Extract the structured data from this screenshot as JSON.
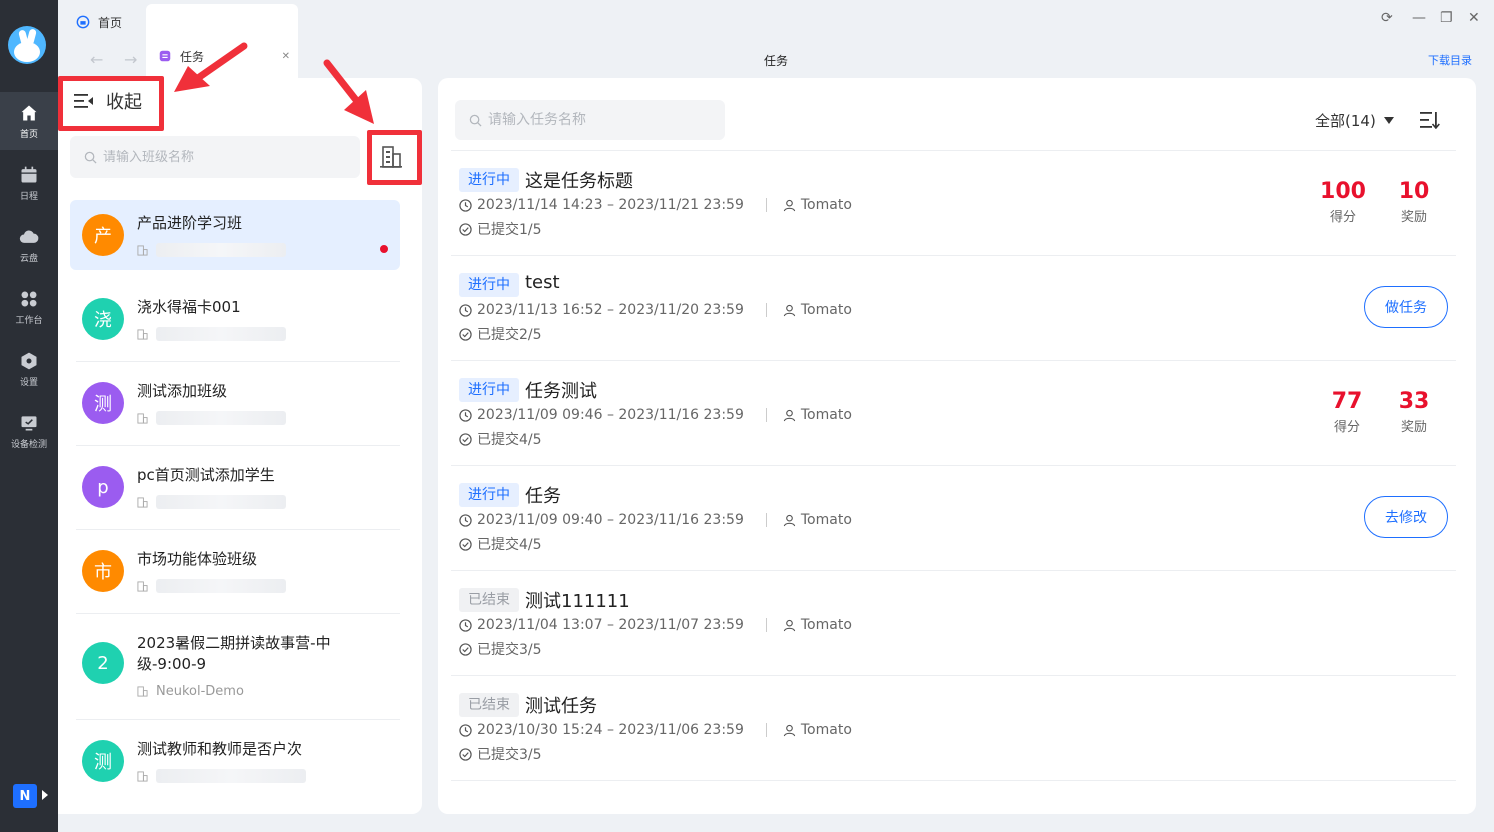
{
  "tabs": [
    {
      "label": "首页"
    },
    {
      "label": "任务"
    }
  ],
  "nav": {
    "title": "任务",
    "download": "下载目录"
  },
  "rail": [
    {
      "label": "首页",
      "icon": "home-icon"
    },
    {
      "label": "日程",
      "icon": "calendar-icon"
    },
    {
      "label": "云盘",
      "icon": "cloud-icon"
    },
    {
      "label": "工作台",
      "icon": "grid-icon"
    },
    {
      "label": "设置",
      "icon": "settings-icon"
    },
    {
      "label": "设备检测",
      "icon": "monitor-icon"
    }
  ],
  "rail_bottom": "N",
  "left": {
    "collapse_label": "收起",
    "search_placeholder": "请输入班级名称",
    "classes": [
      {
        "avatar": "产",
        "name": "产品进阶学习班",
        "sub": "",
        "color": "#ff8a00"
      },
      {
        "avatar": "浇",
        "name": "浇水得福卡001",
        "sub": "",
        "color": "#1fd1b0"
      },
      {
        "avatar": "测",
        "name": "测试添加班级",
        "sub": "",
        "color": "#9b5cf0"
      },
      {
        "avatar": "p",
        "name": "pc首页测试添加学生",
        "sub": "",
        "color": "#9b5cf0"
      },
      {
        "avatar": "市",
        "name": "市场功能体验班级",
        "sub": "",
        "color": "#ff8a00"
      },
      {
        "avatar": "2",
        "name": "2023暑假二期拼读故事营-中级-9:00-9",
        "sub": "Neukol-Demo",
        "color": "#1fd1b0"
      },
      {
        "avatar": "测",
        "name": "测试教师和教师是否户次",
        "sub": "",
        "color": "#1fd1b0"
      }
    ]
  },
  "right": {
    "search_placeholder": "请输入任务名称",
    "filter_label": "全部(14)",
    "tasks": [
      {
        "status": "进行中",
        "title": "这是任务标题",
        "time": "2023/11/14 14:23 – 2023/11/21 23:59",
        "owner": "Tomato",
        "submitted": "已提交1/5",
        "score": "100",
        "score_label": "得分",
        "reward": "10",
        "reward_label": "奖励"
      },
      {
        "status": "进行中",
        "title": "test",
        "time": "2023/11/13 16:52 – 2023/11/20 23:59",
        "owner": "Tomato",
        "submitted": "已提交2/5",
        "button": "做任务"
      },
      {
        "status": "进行中",
        "title": "任务测试",
        "time": "2023/11/09 09:46 – 2023/11/16 23:59",
        "owner": "Tomato",
        "submitted": "已提交4/5",
        "score": "77",
        "score_label": "得分",
        "reward": "33",
        "reward_label": "奖励"
      },
      {
        "status": "进行中",
        "title": "任务",
        "time": "2023/11/09 09:40 – 2023/11/16 23:59",
        "owner": "Tomato",
        "submitted": "已提交4/5",
        "button": "去修改"
      },
      {
        "status": "已结束",
        "title": "测试111111",
        "time": "2023/11/04 13:07 – 2023/11/07 23:59",
        "owner": "Tomato",
        "submitted": "已提交3/5"
      },
      {
        "status": "已结束",
        "title": "测试任务",
        "time": "2023/10/30 15:24 – 2023/11/06 23:59",
        "owner": "Tomato",
        "submitted": "已提交3/5"
      }
    ]
  },
  "colors": {
    "accent": "#1e6fff",
    "score_red": "#e8112d",
    "annotation_red": "#f0303a"
  }
}
